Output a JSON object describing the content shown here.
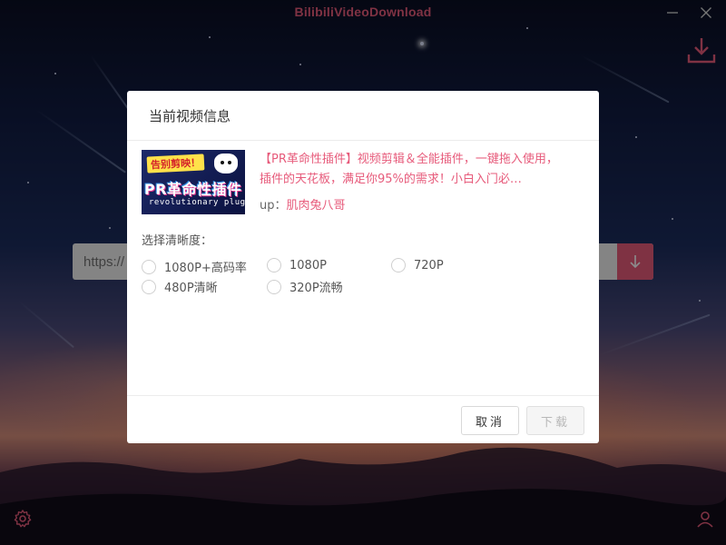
{
  "app": {
    "title": "BilibiliVideoDownload",
    "accent": "#e75b7b"
  },
  "window": {
    "minimize_icon": "minus-icon",
    "close_icon": "close-icon"
  },
  "main": {
    "url_placeholder": "https://",
    "download_corner_icon": "download-tray-icon",
    "submit_icon": "arrow-down-icon",
    "settings_icon": "gear-icon",
    "user_icon": "user-icon"
  },
  "modal": {
    "title": "当前视频信息",
    "thumbnail": {
      "top_text": "告别剪映！",
      "main_text": "PR革命性插件",
      "sub_text": "revolutionary plugin"
    },
    "video_title": "【PR革命性插件】视频剪辑＆全能插件，一键拖入使用，插件的天花板，满足你95%的需求！小白入门必…",
    "uploader_label": "up：",
    "uploader_name": "肌肉兔八哥",
    "quality_label": "选择清晰度：",
    "qualities": [
      "1080P+高码率",
      "1080P",
      "720P",
      "480P清晰",
      "320P流畅"
    ],
    "buttons": {
      "cancel": "取消",
      "download": "下载"
    }
  }
}
